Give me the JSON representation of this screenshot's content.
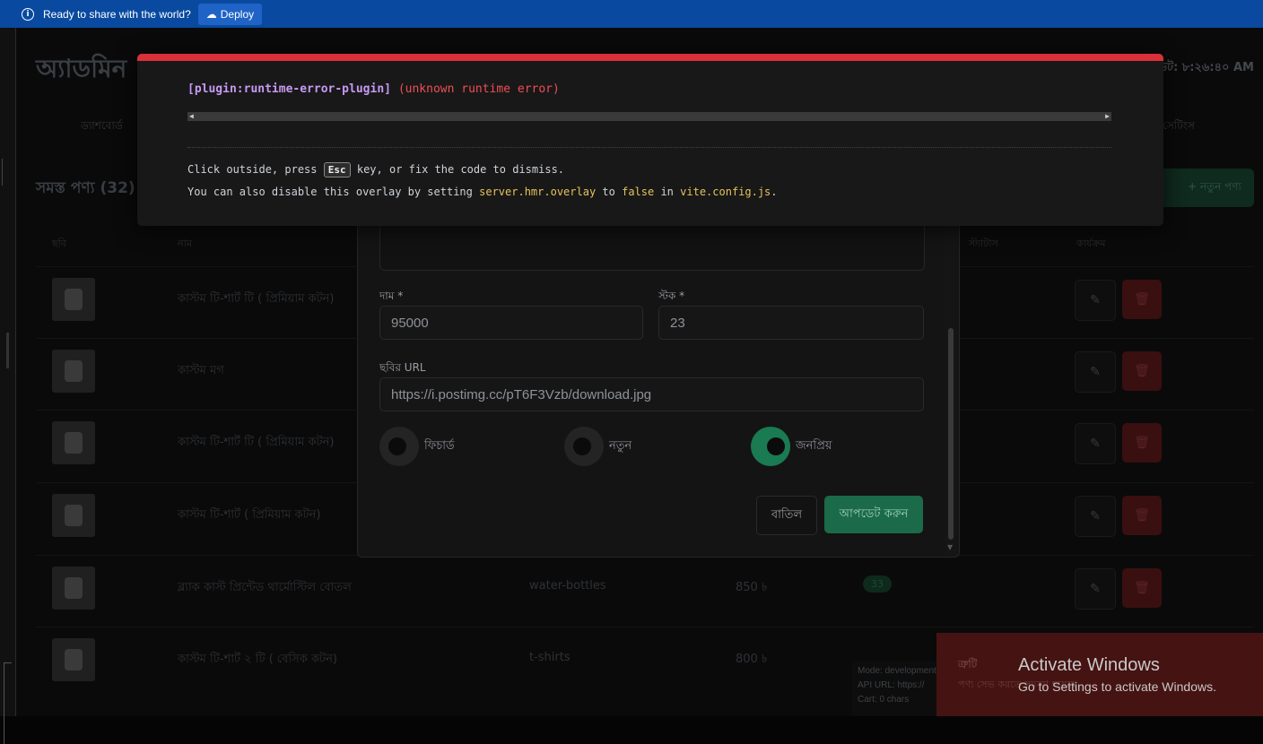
{
  "topbar": {
    "message": "Ready to share with the world?",
    "deploy_label": "Deploy"
  },
  "app": {
    "title": "অ্যাডমিন",
    "time": "আপডেট: ৮:২৬:৪০ AM",
    "nav_left": "ড্যাশবোর্ড",
    "nav_right": "সেটিংস",
    "section_title": "সমস্ত পণ্য (32)",
    "new_product_label": "+ নতুন পণ্য",
    "columns": [
      "ছবি",
      "নাম",
      "স্ট্যাটাস",
      "কার্যক্রম"
    ]
  },
  "products": [
    {
      "name": "কাস্টম টি-শার্ট টি ( প্রিমিয়াম কটন)"
    },
    {
      "name": "কাস্টম মগ"
    },
    {
      "name": "কাস্টম টি-শার্ট টি ( প্রিমিয়াম কটন)"
    },
    {
      "name": "কাস্টম টি-শার্ট ( প্রিমিয়াম কটন)"
    },
    {
      "name": "ব্ল্যাক কাস্ট প্রিন্টেড থার্মোস্টিল বোতল",
      "category": "water-bottles",
      "price": "850 ৳",
      "stock": "33"
    },
    {
      "name": "কাস্টম টি-শার্ট ২ টি ( বেসিক কটন)",
      "category": "t-shirts",
      "price": "800 ৳"
    }
  ],
  "modal": {
    "price_label": "দাম *",
    "price_value": "95000",
    "stock_label": "স্টক *",
    "stock_value": "23",
    "image_url_label": "ছবির URL",
    "image_url_value": "https://i.postimg.cc/pT6F3Vzb/download.jpg",
    "toggles": [
      {
        "label": "ফিচার্ড",
        "on": false
      },
      {
        "label": "নতুন",
        "on": false
      },
      {
        "label": "জনপ্রিয়",
        "on": true
      }
    ],
    "cancel_label": "বাতিল",
    "update_label": "আপডেট করুন"
  },
  "overlay": {
    "plugin": "[plugin:runtime-error-plugin]",
    "error": "(unknown runtime error)",
    "tip_pre": "Click outside, press",
    "tip_key": "Esc",
    "tip_post": "key, or fix the code to dismiss.",
    "tip2_pre": "You can also disable this overlay by setting",
    "tip2_code1": "server.hmr.overlay",
    "tip2_mid": "to",
    "tip2_code2": "false",
    "tip2_in": "in",
    "tip2_code3": "vite.config.js",
    "tip2_end": "."
  },
  "dev_panel": {
    "mode": "Mode: development",
    "api": "API URL: https://",
    "cart": "Cart: 0 chars"
  },
  "toast": {
    "title": "ত্রুটি",
    "message": "পণ্য সেভ করতে সমস্যা হয়েছে"
  },
  "windows": {
    "title": "Activate Windows",
    "subtitle": "Go to Settings to activate Windows."
  }
}
